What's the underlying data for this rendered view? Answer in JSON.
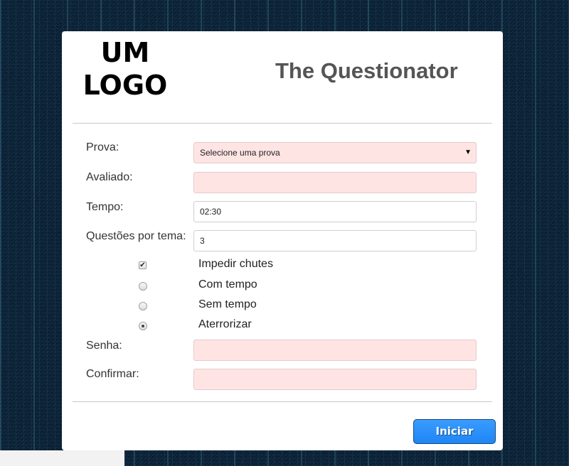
{
  "header": {
    "logo_line1": "UM",
    "logo_line2": "LOGO",
    "title": "The Questionator"
  },
  "form": {
    "prova": {
      "label": "Prova:",
      "value": "Selecione uma prova"
    },
    "avaliado": {
      "label": "Avaliado:",
      "value": ""
    },
    "tempo": {
      "label": "Tempo:",
      "value": "02:30"
    },
    "questoes": {
      "label": "Questões por tema:",
      "value": "3"
    },
    "options": [
      {
        "label": "Impedir chutes",
        "type": "checkbox",
        "checked": true
      },
      {
        "label": "Com tempo",
        "type": "radio",
        "checked": false
      },
      {
        "label": "Sem tempo",
        "type": "radio",
        "checked": false
      },
      {
        "label": "Aterrorizar",
        "type": "radio",
        "checked": true
      }
    ],
    "senha": {
      "label": "Senha:",
      "value": ""
    },
    "confirmar": {
      "label": "Confirmar:",
      "value": ""
    }
  },
  "actions": {
    "start_label": "Iniciar"
  },
  "colors": {
    "invalid_field_bg": "#ffe4e4",
    "button_blue": "#2a8ff8",
    "title_gray": "#555555"
  }
}
